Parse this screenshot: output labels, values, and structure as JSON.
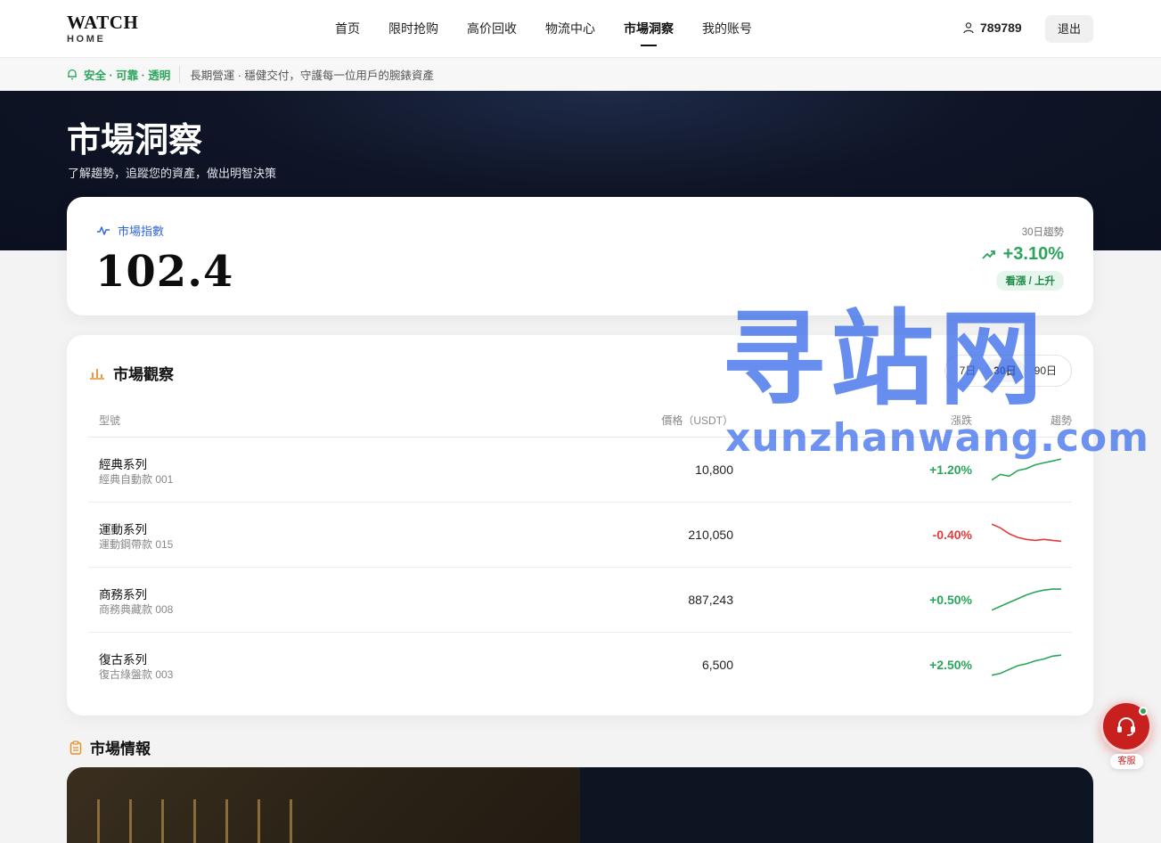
{
  "header": {
    "logo_main": "WATCH",
    "logo_sub": "HOME",
    "nav": [
      {
        "label": "首页"
      },
      {
        "label": "限时抢购"
      },
      {
        "label": "高价回收"
      },
      {
        "label": "物流中心"
      },
      {
        "label": "市場洞察"
      },
      {
        "label": "我的账号"
      }
    ],
    "active_nav": "市場洞察",
    "username": "789789",
    "logout_label": "退出"
  },
  "notice": {
    "tag": "安全 · 可靠 · 透明",
    "text": "長期營運 · 穩健交付，守護每一位用戶的腕錶資產"
  },
  "hero": {
    "title": "市場洞察",
    "subtitle": "了解趨勢，追蹤您的資產，做出明智決策"
  },
  "index_card": {
    "label": "市場指數",
    "value": "102.4",
    "trend_label": "30日趨勢",
    "trend_value": "+3.10%",
    "trend_badge": "看漲 / 上升"
  },
  "watch": {
    "title": "市場觀察",
    "ranges": [
      "7日",
      "30日",
      "90日"
    ],
    "active_range": "30日",
    "columns": {
      "model": "型號",
      "price": "價格（USDT）",
      "change": "漲跌",
      "trend": "趨勢"
    },
    "rows": [
      {
        "name": "經典系列",
        "sub": "經典自動款 001",
        "price": "10,800",
        "change": "+1.20%",
        "direction": "up",
        "spark": [
          2,
          5,
          4,
          7,
          8,
          10,
          11,
          12,
          13
        ]
      },
      {
        "name": "運動系列",
        "sub": "運動鋼帶款 015",
        "price": "210,050",
        "change": "-0.40%",
        "direction": "down",
        "spark": [
          13,
          11,
          8,
          6,
          5,
          4.5,
          5,
          4.5,
          4
        ]
      },
      {
        "name": "商務系列",
        "sub": "商務典藏款 008",
        "price": "887,243",
        "change": "+0.50%",
        "direction": "up",
        "spark": [
          2,
          4,
          6,
          8,
          10,
          11.5,
          12.5,
          13,
          13
        ]
      },
      {
        "name": "復古系列",
        "sub": "復古綠盤款 003",
        "price": "6,500",
        "change": "+2.50%",
        "direction": "up",
        "spark": [
          2,
          3,
          5,
          7,
          8,
          9.5,
          10.5,
          12,
          12.5
        ]
      }
    ]
  },
  "news": {
    "title": "市場情報"
  },
  "support": {
    "label": "客服"
  },
  "watermark": {
    "main": "寻站网",
    "sub": "xunzhanwang.com"
  },
  "colors": {
    "up": "#2aa55b",
    "down": "#e23b3b",
    "accent_blue": "#2f66d9",
    "support_red": "#c8201f"
  }
}
